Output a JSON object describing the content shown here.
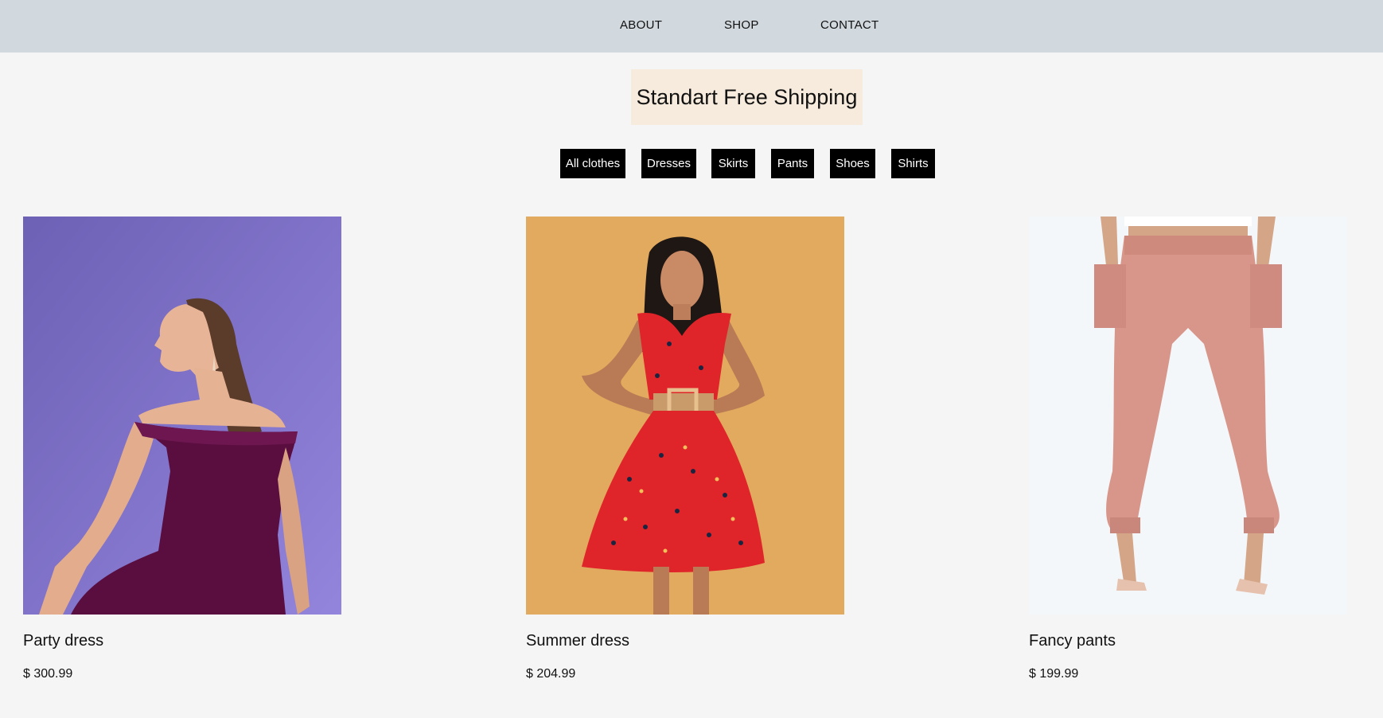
{
  "nav": {
    "items": [
      {
        "label": "ABOUT"
      },
      {
        "label": "SHOP"
      },
      {
        "label": "CONTACT"
      }
    ]
  },
  "banner": {
    "text": "Standart Free Shipping"
  },
  "filters": [
    {
      "label": "All clothes"
    },
    {
      "label": "Dresses"
    },
    {
      "label": "Skirts"
    },
    {
      "label": "Pants"
    },
    {
      "label": "Shoes"
    },
    {
      "label": "Shirts"
    }
  ],
  "products": [
    {
      "name": "Party dress",
      "price": "$ 300.99",
      "image_bg": "#7e6fcb",
      "garment_color": "#5a0d3f"
    },
    {
      "name": "Summer dress",
      "price": "$ 204.99",
      "image_bg": "#e2aa5e",
      "garment_color": "#e0252a"
    },
    {
      "name": "Fancy pants",
      "price": "$ 199.99",
      "image_bg": "#f3f7fa",
      "garment_color": "#d8968a"
    }
  ],
  "colors": {
    "nav_bg": "#d1d8de",
    "page_bg": "#f5f5f5",
    "banner_bg": "#f6ebdc",
    "button_bg": "#000000",
    "button_text": "#ffffff"
  }
}
